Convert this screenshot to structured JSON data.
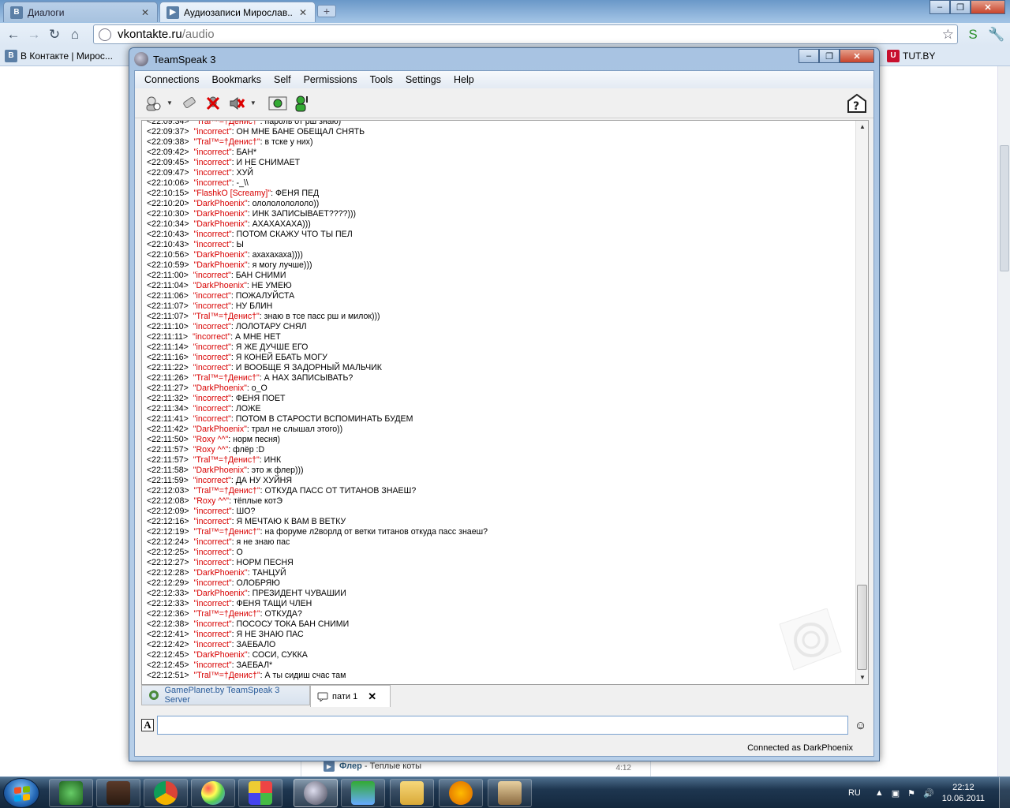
{
  "browser": {
    "tabs": [
      {
        "title": "Диалоги",
        "icon": "vk-icon"
      },
      {
        "title": "Аудиозаписи Мирослав...",
        "icon": "vk-icon"
      }
    ],
    "url_host": "vkontakte.ru",
    "url_path": "/audio",
    "bookmarks": [
      {
        "label": "В Контакте | Мирос..."
      },
      {
        "label": "TUT.BY"
      }
    ]
  },
  "page": {
    "audio_artist": "Флер",
    "audio_separator": " - ",
    "audio_title": "Теплые коты",
    "audio_duration": "4:12"
  },
  "teamspeak": {
    "title": "TeamSpeak 3",
    "menu": [
      "Connections",
      "Bookmarks",
      "Self",
      "Permissions",
      "Tools",
      "Settings",
      "Help"
    ],
    "chat": [
      {
        "ts": "<22:09:37>",
        "nick": "\"incorrect\"",
        "msg": ": ОН МНЕ БАНЕ ОБЕЩАЛ СНЯТЬ"
      },
      {
        "ts": "<22:09:38>",
        "nick": "\"Tral™=†Денис†\"",
        "msg": ": в тске у них)"
      },
      {
        "ts": "<22:09:42>",
        "nick": "\"incorrect\"",
        "msg": ": БАН*"
      },
      {
        "ts": "<22:09:45>",
        "nick": "\"incorrect\"",
        "msg": ": И НЕ СНИМАЕТ"
      },
      {
        "ts": "<22:09:47>",
        "nick": "\"incorrect\"",
        "msg": ": ХУЙ"
      },
      {
        "ts": "<22:10:06>",
        "nick": "\"incorrect\"",
        "msg": ": -_\\\\"
      },
      {
        "ts": "<22:10:15>",
        "nick": "\"FlashkO [Screamy]\"",
        "msg": ": ФЕНЯ ПЕД"
      },
      {
        "ts": "<22:10:20>",
        "nick": "\"DarkPhoenix\"",
        "msg": ": ололололололо))"
      },
      {
        "ts": "<22:10:30>",
        "nick": "\"DarkPhoenix\"",
        "msg": ": ИНК ЗАПИСЫВАЕТ????)))"
      },
      {
        "ts": "<22:10:34>",
        "nick": "\"DarkPhoenix\"",
        "msg": ": АХАХАХАХА)))"
      },
      {
        "ts": "<22:10:43>",
        "nick": "\"incorrect\"",
        "msg": ": ПОТОМ СКАЖУ ЧТО ТЫ ПЕЛ"
      },
      {
        "ts": "<22:10:43>",
        "nick": "\"incorrect\"",
        "msg": ": Ы"
      },
      {
        "ts": "<22:10:56>",
        "nick": "\"DarkPhoenix\"",
        "msg": ": ахахахаха))))"
      },
      {
        "ts": "<22:10:59>",
        "nick": "\"DarkPhoenix\"",
        "msg": ": я могу лучше)))"
      },
      {
        "ts": "<22:11:00>",
        "nick": "\"incorrect\"",
        "msg": ": БАН СНИМИ"
      },
      {
        "ts": "<22:11:04>",
        "nick": "\"DarkPhoenix\"",
        "msg": ": НЕ УМЕЮ"
      },
      {
        "ts": "<22:11:06>",
        "nick": "\"incorrect\"",
        "msg": ": ПОЖАЛУЙСТА"
      },
      {
        "ts": "<22:11:07>",
        "nick": "\"incorrect\"",
        "msg": ": НУ БЛИН"
      },
      {
        "ts": "<22:11:07>",
        "nick": "\"Tral™=†Денис†\"",
        "msg": ": знаю в тсе пасс рш и милок)))"
      },
      {
        "ts": "<22:11:10>",
        "nick": "\"incorrect\"",
        "msg": ": ЛОЛОТАРУ СНЯЛ"
      },
      {
        "ts": "<22:11:11>",
        "nick": "\"incorrect\"",
        "msg": ": А МНЕ НЕТ"
      },
      {
        "ts": "<22:11:14>",
        "nick": "\"incorrect\"",
        "msg": ": Я ЖЕ ДУЧШЕ ЕГО"
      },
      {
        "ts": "<22:11:16>",
        "nick": "\"incorrect\"",
        "msg": ": Я КОНЕЙ ЕБАТЬ МОГУ"
      },
      {
        "ts": "<22:11:22>",
        "nick": "\"incorrect\"",
        "msg": ": И ВООБЩЕ Я ЗАДОРНЫЙ МАЛЬЧИК"
      },
      {
        "ts": "<22:11:26>",
        "nick": "\"Tral™=†Денис†\"",
        "msg": ": А НАХ ЗАПИСЫВАТЬ?"
      },
      {
        "ts": "<22:11:27>",
        "nick": "\"DarkPhoenix\"",
        "msg": ": o_O"
      },
      {
        "ts": "<22:11:32>",
        "nick": "\"incorrect\"",
        "msg": ": ФЕНЯ ПОЕТ"
      },
      {
        "ts": "<22:11:34>",
        "nick": "\"incorrect\"",
        "msg": ": ЛОЖЕ"
      },
      {
        "ts": "<22:11:41>",
        "nick": "\"incorrect\"",
        "msg": ": ПОТОМ В СТАРОСТИ ВСПОМИНАТЬ БУДЕМ"
      },
      {
        "ts": "<22:11:42>",
        "nick": "\"DarkPhoenix\"",
        "msg": ": трал не слышал этого))"
      },
      {
        "ts": "<22:11:50>",
        "nick": "\"Roxy ^^\"",
        "msg": ": норм песня)"
      },
      {
        "ts": "<22:11:57>",
        "nick": "\"Roxy ^^\"",
        "msg": ": флёр :D"
      },
      {
        "ts": "<22:11:57>",
        "nick": "\"Tral™=†Денис†\"",
        "msg": ": ИНК"
      },
      {
        "ts": "<22:11:58>",
        "nick": "\"DarkPhoenix\"",
        "msg": ": это ж флер)))"
      },
      {
        "ts": "<22:11:59>",
        "nick": "\"incorrect\"",
        "msg": ": ДА НУ ХУЙНЯ"
      },
      {
        "ts": "<22:12:03>",
        "nick": "\"Tral™=†Денис†\"",
        "msg": ": ОТКУДА ПАСС ОТ ТИТАНОВ ЗНАЕШ?"
      },
      {
        "ts": "<22:12:08>",
        "nick": "\"Roxy ^^\"",
        "msg": ": тёплые котЭ"
      },
      {
        "ts": "<22:12:09>",
        "nick": "\"incorrect\"",
        "msg": ": ШО?"
      },
      {
        "ts": "<22:12:16>",
        "nick": "\"incorrect\"",
        "msg": ": Я МЕЧТАЮ К ВАМ В ВЕТКУ"
      },
      {
        "ts": "<22:12:19>",
        "nick": "\"Tral™=†Денис†\"",
        "msg": ": на форуме л2ворлд от ветки титанов откуда пасс знаеш?"
      },
      {
        "ts": "<22:12:24>",
        "nick": "\"incorrect\"",
        "msg": ": я не знаю пас"
      },
      {
        "ts": "<22:12:25>",
        "nick": "\"incorrect\"",
        "msg": ": О"
      },
      {
        "ts": "<22:12:27>",
        "nick": "\"incorrect\"",
        "msg": ": НОРМ ПЕСНЯ"
      },
      {
        "ts": "<22:12:28>",
        "nick": "\"DarkPhoenix\"",
        "msg": ": ТАНЦУЙ"
      },
      {
        "ts": "<22:12:29>",
        "nick": "\"incorrect\"",
        "msg": ": ОЛОБРЯЮ"
      },
      {
        "ts": "<22:12:33>",
        "nick": "\"DarkPhoenix\"",
        "msg": ": ПРЕЗИДЕНТ ЧУВАШИИ"
      },
      {
        "ts": "<22:12:33>",
        "nick": "\"incorrect\"",
        "msg": ": ФЕНЯ ТАЩИ ЧЛЕН"
      },
      {
        "ts": "<22:12:36>",
        "nick": "\"Tral™=†Денис†\"",
        "msg": ": ОТКУДА?"
      },
      {
        "ts": "<22:12:38>",
        "nick": "\"incorrect\"",
        "msg": ": ПОСОСУ ТОКА БАН СНИМИ"
      },
      {
        "ts": "<22:12:41>",
        "nick": "\"incorrect\"",
        "msg": ": Я НЕ ЗНАЮ ПАС"
      },
      {
        "ts": "<22:12:42>",
        "nick": "\"incorrect\"",
        "msg": ": ЗАЕБАЛО"
      },
      {
        "ts": "<22:12:45>",
        "nick": "\"DarkPhoenix\"",
        "msg": ": СОСИ, СУККА"
      },
      {
        "ts": "<22:12:45>",
        "nick": "\"incorrect\"",
        "msg": ": ЗАЕБАЛ*"
      },
      {
        "ts": "<22:12:51>",
        "nick": "\"Tral™=†Денис†\"",
        "msg": ": А ты сидиш счас там"
      }
    ],
    "server_tab": "GamePlanet.by TeamSpeak 3 Server",
    "channel_tab": "пати 1",
    "input_value": "",
    "status": "Connected as DarkPhoenix",
    "nick_color": "#d80000"
  },
  "taskbar": {
    "lang": "RU",
    "time": "22:12",
    "date": "10.06.2011"
  }
}
